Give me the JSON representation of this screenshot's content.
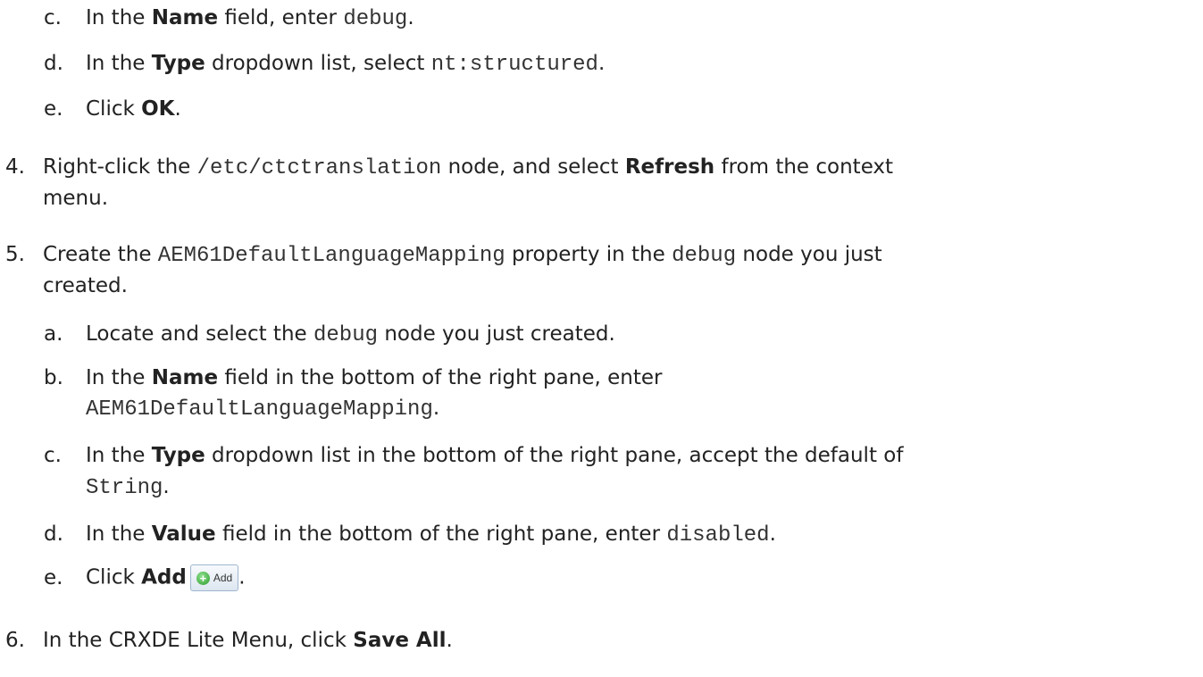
{
  "steps": {
    "s3": {
      "c": {
        "num": "c.",
        "t1": "In the ",
        "b1": "Name",
        "t2": " field, enter ",
        "code": "debug",
        "t3": "."
      },
      "d": {
        "num": "d.",
        "t1": "In the ",
        "b1": "Type",
        "t2": " dropdown list, select ",
        "code": "nt:structured",
        "t3": "."
      },
      "e": {
        "num": "e.",
        "t1": "Click ",
        "b1": "OK",
        "t2": "."
      }
    },
    "s4": {
      "num": "4.",
      "t1": "Right-click the ",
      "code": "/etc/ctctranslation",
      "t2": " node, and select ",
      "b1": "Refresh",
      "t3": " from the context",
      "t4": "menu."
    },
    "s5": {
      "num": "5.",
      "t1": "Create the ",
      "code1": "AEM61DefaultLanguageMapping",
      "t2": " property in the ",
      "code2": "debug",
      "t3": " node you just",
      "t4": "created.",
      "a": {
        "num": "a.",
        "t1": "Locate and select the ",
        "code": "debug",
        "t2": " node you just created."
      },
      "b": {
        "num": "b.",
        "t1": "In the ",
        "b1": "Name",
        "t2": " field in the bottom of the right pane, enter",
        "code": "AEM61DefaultLanguageMapping",
        "t3": "."
      },
      "c": {
        "num": "c.",
        "t1": "In the ",
        "b1": "Type",
        "t2": " dropdown list in the bottom of the right pane, accept the default of",
        "code": "String",
        "t3": "."
      },
      "d": {
        "num": "d.",
        "t1": "In the ",
        "b1": "Value",
        "t2": " field in the bottom of the right pane, enter ",
        "code": "disabled",
        "t3": "."
      },
      "e": {
        "num": "e.",
        "t1": "Click ",
        "b1": "Add",
        "button_label": "Add",
        "t2": "."
      }
    },
    "s6": {
      "num": "6.",
      "t1": "In the CRXDE Lite Menu, click ",
      "b1": "Save All",
      "t2": "."
    }
  }
}
